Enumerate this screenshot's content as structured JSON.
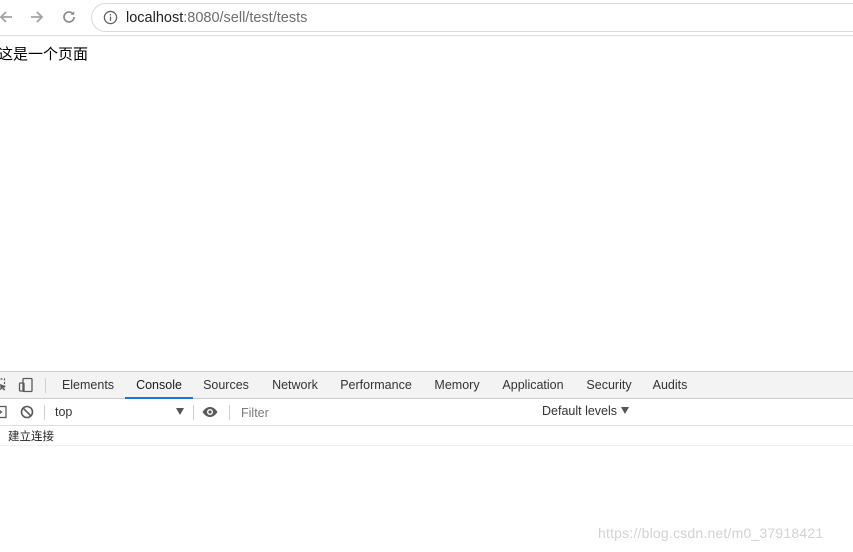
{
  "browser": {
    "url_host": "localhost",
    "url_path": ":8080/sell/test/tests"
  },
  "page": {
    "text": "这是一个页面"
  },
  "devtools": {
    "tabs": [
      {
        "label": "Elements"
      },
      {
        "label": "Console"
      },
      {
        "label": "Sources"
      },
      {
        "label": "Network"
      },
      {
        "label": "Performance"
      },
      {
        "label": "Memory"
      },
      {
        "label": "Application"
      },
      {
        "label": "Security"
      },
      {
        "label": "Audits"
      }
    ],
    "active_tab": "Console",
    "context": "top",
    "filter_placeholder": "Filter",
    "levels_label": "Default levels",
    "logs": [
      "建立连接"
    ],
    "accent_color": "#1a73e8"
  },
  "watermark": "https://blog.csdn.net/m0_37918421"
}
